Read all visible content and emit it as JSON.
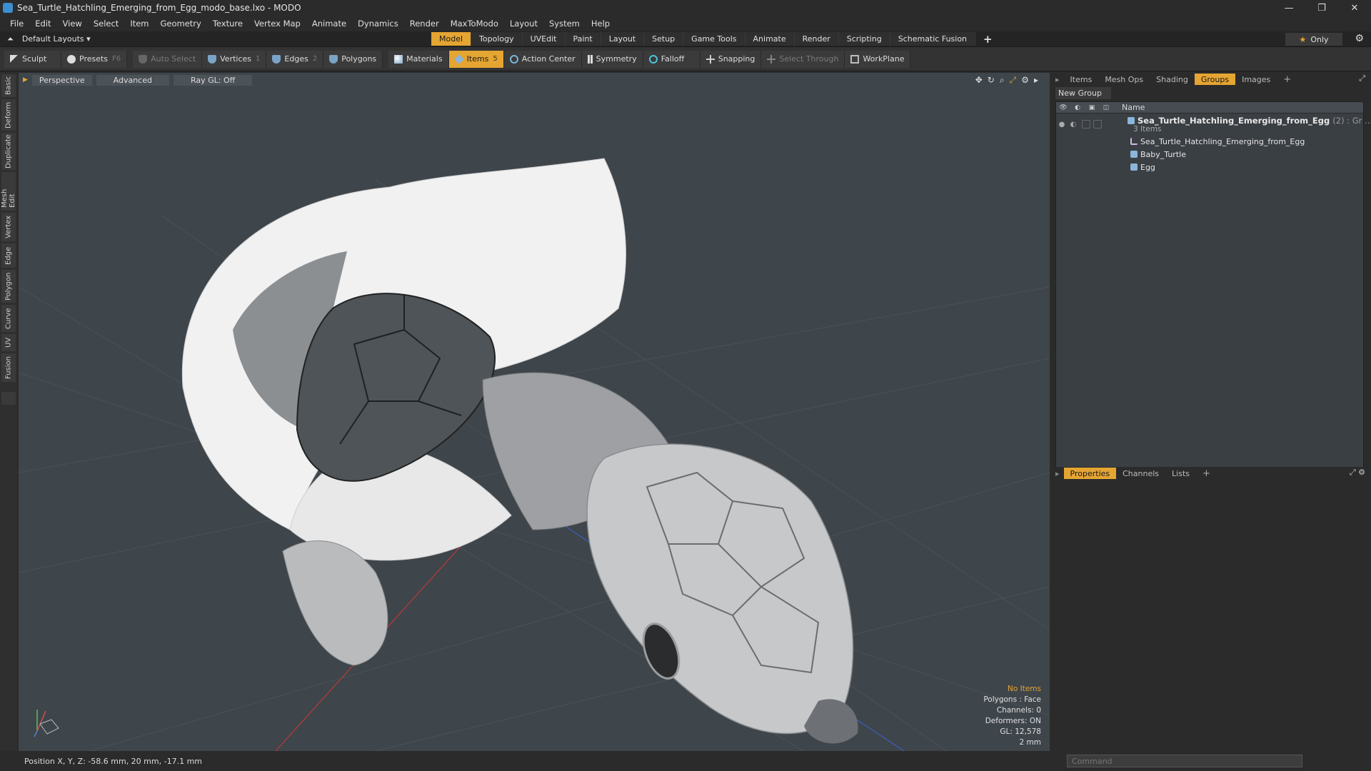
{
  "window": {
    "title": "Sea_Turtle_Hatchling_Emerging_from_Egg_modo_base.lxo - MODO",
    "minimize": "—",
    "restore": "❐",
    "close": "✕"
  },
  "menu": [
    "File",
    "Edit",
    "View",
    "Select",
    "Item",
    "Geometry",
    "Texture",
    "Vertex Map",
    "Animate",
    "Dynamics",
    "Render",
    "MaxToModo",
    "Layout",
    "System",
    "Help"
  ],
  "layout_selector": {
    "label": "Default Layouts ▾"
  },
  "mode_tabs": [
    "Model",
    "Topology",
    "UVEdit",
    "Paint",
    "Layout",
    "Setup",
    "Game Tools",
    "Animate",
    "Render",
    "Scripting",
    "Schematic Fusion"
  ],
  "mode_active": "Model",
  "only_label": "Only",
  "toolbar": {
    "sculpt": "Sculpt",
    "presets": "Presets",
    "presets_key": "F6",
    "auto_select": "Auto Select",
    "vertices": "Vertices",
    "vertices_key": "1",
    "edges": "Edges",
    "edges_key": "2",
    "polygons": "Polygons",
    "materials": "Materials",
    "items": "Items",
    "items_key": "5",
    "action_center": "Action Center",
    "symmetry": "Symmetry",
    "falloff": "Falloff",
    "snapping": "Snapping",
    "select_through": "Select Through",
    "workplane": "WorkPlane"
  },
  "left_tabs": [
    "Basic",
    "Deform",
    "Duplicate",
    "Mesh Edit",
    "Vertex",
    "Edge",
    "Polygon",
    "Curve",
    "UV",
    "Fusion"
  ],
  "viewport": {
    "view": "Perspective",
    "shading": "Advanced",
    "raygl": "Ray GL: Off",
    "stats": {
      "selection": "No Items",
      "polygons": "Polygons : Face",
      "channels": "Channels: 0",
      "deformers": "Deformers: ON",
      "gl": "GL: 12,578",
      "scale": "2 mm"
    }
  },
  "status": {
    "position": "Position X, Y, Z:   -58.6 mm, 20 mm, -17.1 mm"
  },
  "right_panel": {
    "tabs": [
      "Items",
      "Mesh Ops",
      "Shading",
      "Groups",
      "Images"
    ],
    "active_tab": "Groups",
    "new_group": "New Group",
    "name_header": "Name",
    "group": {
      "name": "Sea_Turtle_Hatchling_Emerging_from_Egg",
      "meta": "(2) : Gr ...",
      "count": "3 Items"
    },
    "items": [
      {
        "name": "Sea_Turtle_Hatchling_Emerging_from_Egg",
        "icon": "locator-icon"
      },
      {
        "name": "Baby_Turtle",
        "icon": "mesh-icon"
      },
      {
        "name": "Egg",
        "icon": "mesh-icon"
      }
    ],
    "props_tabs": [
      "Properties",
      "Channels",
      "Lists"
    ],
    "props_active": "Properties"
  },
  "command": {
    "placeholder": "Command"
  },
  "colors": {
    "accent": "#e5a532",
    "viewport": "#3e454b",
    "panel": "#2b2b2b"
  }
}
